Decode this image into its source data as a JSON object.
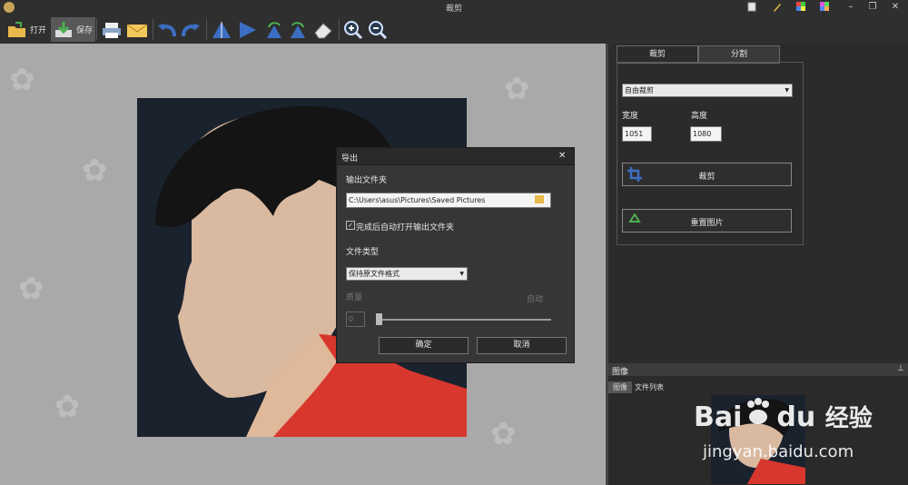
{
  "window": {
    "title": "裁剪",
    "controls": [
      "new-doc-icon",
      "edit-icon",
      "palette-icon",
      "grid-icon",
      "minimize",
      "restore",
      "close"
    ]
  },
  "toolbar": {
    "open_label": "打开",
    "save_label": "保存",
    "icons": [
      "print-icon",
      "mail-icon",
      "undo-icon",
      "redo-icon",
      "flip-vertical-icon",
      "flip-horizontal-icon",
      "rotate-left-icon",
      "rotate-right-icon",
      "eraser-icon",
      "zoom-in-icon",
      "zoom-out-icon"
    ]
  },
  "dialog": {
    "title": "导出",
    "close_glyph": "✕",
    "output_folder_label": "输出文件夹",
    "output_path": "C:\\Users\\asus\\Pictures\\Saved Pictures",
    "auto_open_label": "完成后自动打开输出文件夹",
    "auto_open_checked": true,
    "file_type_label": "文件类型",
    "file_type_value": "保持原文件格式",
    "quality_label": "质量",
    "auto_label": "自动",
    "quality_value": "0",
    "quality_slider": 0,
    "ok_label": "确定",
    "cancel_label": "取消"
  },
  "right_panel": {
    "tabs": [
      {
        "label": "裁剪",
        "active": true
      },
      {
        "label": "分割",
        "active": false
      }
    ],
    "mode_value": "自由裁剪",
    "width_label": "宽度",
    "height_label": "高度",
    "width_value": "1051",
    "height_value": "1080",
    "crop_button": "裁剪",
    "reset_button": "重置图片"
  },
  "image_panel": {
    "title": "图像",
    "pin_glyph": "⊥",
    "tabs": [
      {
        "label": "图像",
        "active": true
      },
      {
        "label": "文件列表",
        "active": false
      }
    ]
  },
  "watermark": {
    "brand": "Bai",
    "brand2": "du",
    "cn": "经验",
    "url": "jingyan.baidu.com"
  },
  "colors": {
    "canvas": "#a9a9a9",
    "panel": "#2b2b2b",
    "accent_blue": "#3c6fc4",
    "shirt": "#d8372d"
  }
}
